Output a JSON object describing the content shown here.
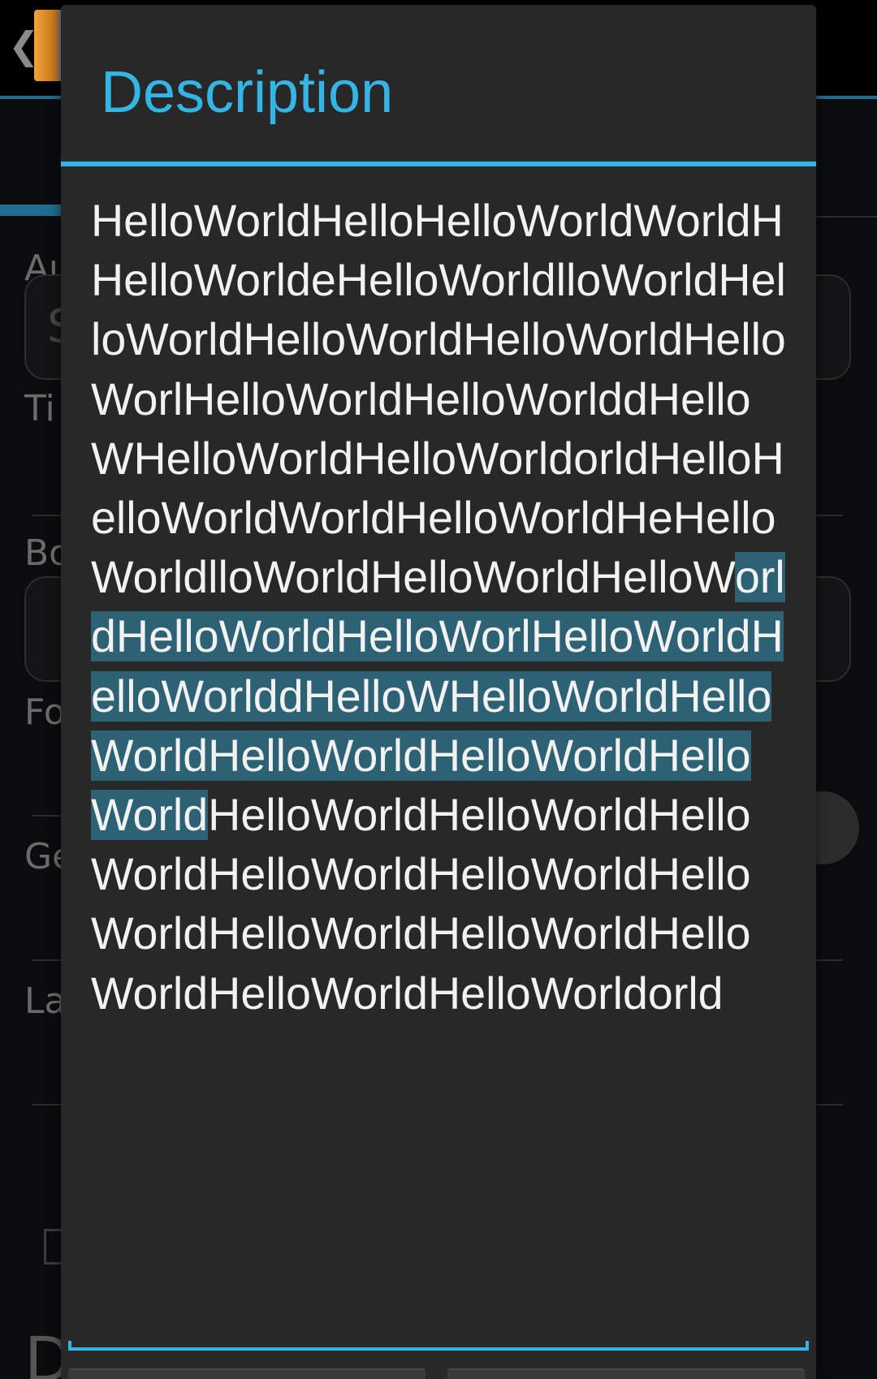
{
  "dialog": {
    "title": "Description",
    "text_before_selection": "HelloWorldHelloHelloWorldWorldHHelloWorldeHelloWorldlloWorldHelloWorldHelloWorldHelloWorldHelloWorlHelloWorldHelloWorlddHelloWHelloWorldHelloWorldorldHelloHelloWorldWorldHelloWorldHeHelloWorldlloWorldHelloWorldHelloW",
    "text_selected": "orldHelloWorldHelloWorlHelloWorldHelloWorlddHelloWHelloWorldHelloWorldHelloWorldHelloWorldHelloWorld",
    "text_after_selection": "HelloWorldHelloWorldHelloWorldHelloWorldHelloWorldHelloWorldHelloWorldHelloWorldHelloWorldHelloWorldHelloWorldorld"
  },
  "colors": {
    "accent": "#33b5e5",
    "dialog_background": "#282828",
    "selection_highlight": "#2d6174",
    "text": "#f2f2f2",
    "screen_background": "#0b0c0d"
  },
  "icons": {
    "back": "chevron-left-icon",
    "app": "app-icon"
  }
}
